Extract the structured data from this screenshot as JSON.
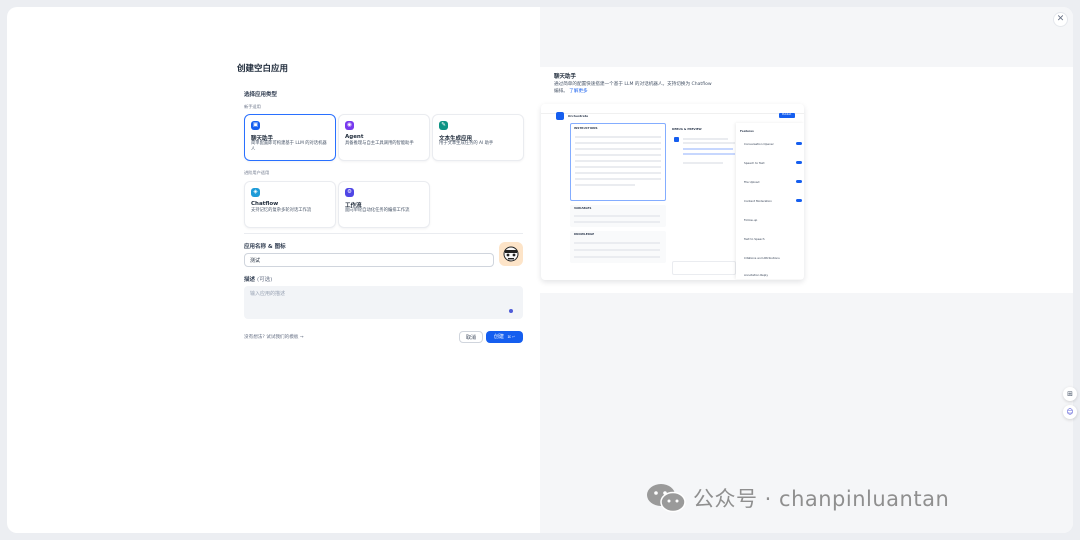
{
  "dialog": {
    "title": "创建空白应用",
    "close_icon": "close-icon"
  },
  "app_type": {
    "heading": "选择应用类型",
    "beginner_label": "新手适用",
    "advanced_label": "进阶用户适用",
    "cards": [
      {
        "name": "聊天助手",
        "desc": "简单配置即可构建基于 LLM 的对话机器人",
        "icon": "chat-bot-icon",
        "color": "#155eef",
        "selected": true
      },
      {
        "name": "Agent",
        "desc": "具备推理与自主工具调用的智能助手",
        "icon": "agent-icon",
        "color": "#7839ee",
        "selected": false
      },
      {
        "name": "文本生成应用",
        "desc": "用于文本生成任务的 AI 助手",
        "icon": "text-generator-icon",
        "color": "#0e9384",
        "selected": false
      },
      {
        "name": "Chatflow",
        "desc": "支持记忆的复杂多轮对话工作流",
        "icon": "chatflow-icon",
        "color": "#1e9bd8",
        "selected": false
      },
      {
        "name": "工作流",
        "desc": "面向单轮自动化任务的编排工作流",
        "icon": "workflow-icon",
        "color": "#4f46e5",
        "selected": false
      }
    ]
  },
  "form": {
    "name_label": "应用名称 & 图标",
    "name_value": "测试",
    "desc_label": "描述",
    "desc_optional": "(可选)",
    "desc_placeholder": "输入应用的描述"
  },
  "footer": {
    "hint": "没有想法? 试试我们的模板 →",
    "cancel": "取消",
    "create": "创建",
    "create_shortcut": "⌘ ↵"
  },
  "preview": {
    "title": "聊天助手",
    "desc": "通过简单的配置快速搭建一个基于 LLM 的对话机器人。支持切换为 Chatflow 编排。",
    "learn_more": "了解更多",
    "app_name": "Orchestrate",
    "instructions": "INSTRUCTIONS",
    "variables": "VARIABLES",
    "knowledge": "KNOWLEDGE",
    "debug": "DEBUG & PREVIEW",
    "features": "Features",
    "features_list": [
      "Conversation Opener",
      "Speech to Text",
      "File Upload",
      "Content Moderation",
      "Follow-up",
      "Text to Speech",
      "Citations and Attributions",
      "Annotation Reply"
    ],
    "publish": "Publish"
  },
  "watermark": {
    "text": "公众号 · chanpinluantan",
    "icon": "wechat-icon"
  },
  "floating": {
    "grid_icon": "grid-icon",
    "bot_icon": "assistant-bot-icon"
  },
  "colors": {
    "primary": "#155eef",
    "selected_border": "#2970ff"
  }
}
